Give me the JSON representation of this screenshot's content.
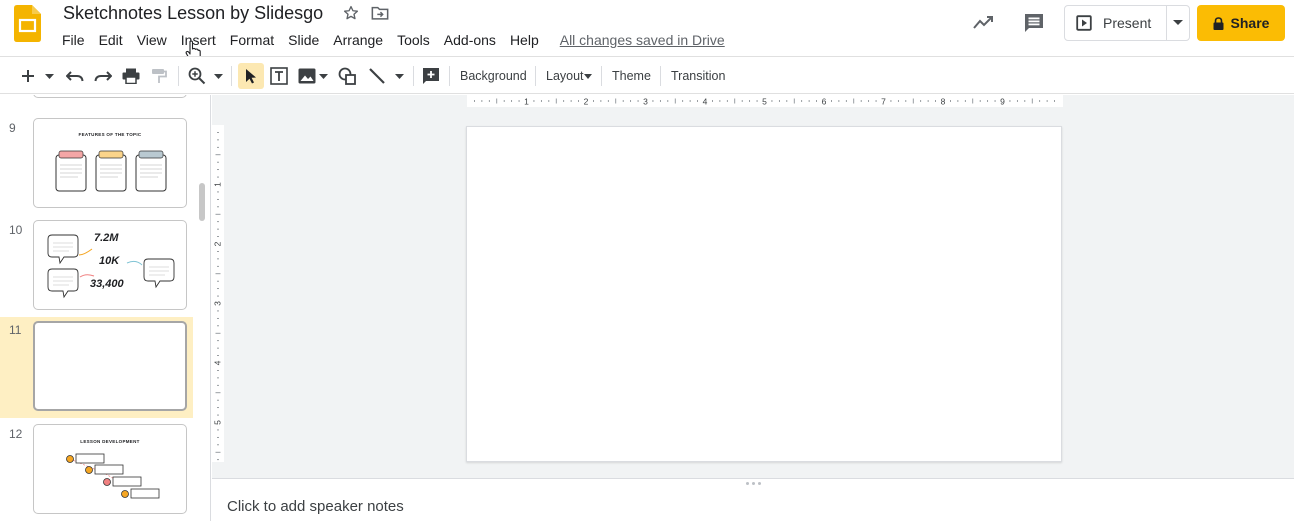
{
  "app": {
    "title": "Sketchnotes Lesson by Slidesgo",
    "saved_status": "All changes saved in Drive",
    "brand_color": "#f4b400",
    "accent_color": "#fbbc04"
  },
  "menu": [
    "File",
    "Edit",
    "View",
    "Insert",
    "Format",
    "Slide",
    "Arrange",
    "Tools",
    "Add-ons",
    "Help"
  ],
  "header_actions": {
    "present_label": "Present",
    "share_label": "Share"
  },
  "toolbar": {
    "background": "Background",
    "layout": "Layout",
    "theme": "Theme",
    "transition": "Transition"
  },
  "ruler": {
    "horizontal": [
      "1",
      "2",
      "3",
      "4",
      "5",
      "6",
      "7",
      "8",
      "9"
    ],
    "vertical": [
      "1",
      "2",
      "3",
      "4",
      "5"
    ]
  },
  "slides": [
    {
      "number": "9",
      "title": "FEATURES OF THE TOPIC",
      "selected": false
    },
    {
      "number": "10",
      "values": [
        "7.2M",
        "10K",
        "33,400"
      ],
      "selected": false
    },
    {
      "number": "11",
      "selected": true
    },
    {
      "number": "12",
      "title": "LESSON DEVELOPMENT",
      "selected": false
    }
  ],
  "notes": {
    "placeholder": "Click to add speaker notes"
  }
}
